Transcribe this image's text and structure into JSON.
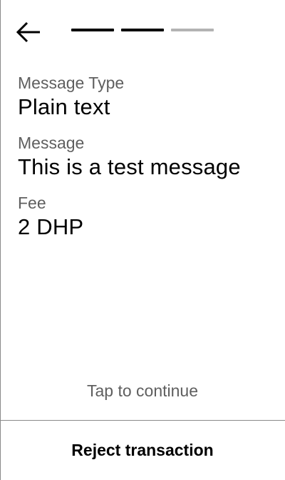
{
  "header": {
    "back_icon": "arrow-left-icon",
    "steps": [
      {
        "state": "done",
        "color": "#000000"
      },
      {
        "state": "done",
        "color": "#000000"
      },
      {
        "state": "pending",
        "color": "#b3b3b3"
      }
    ]
  },
  "fields": [
    {
      "label": "Message Type",
      "value": "Plain text"
    },
    {
      "label": "Message",
      "value": "This is a test message"
    },
    {
      "label": "Fee",
      "value": "2 DHP"
    }
  ],
  "tap_to_continue": "Tap to continue",
  "reject_label": "Reject transaction"
}
